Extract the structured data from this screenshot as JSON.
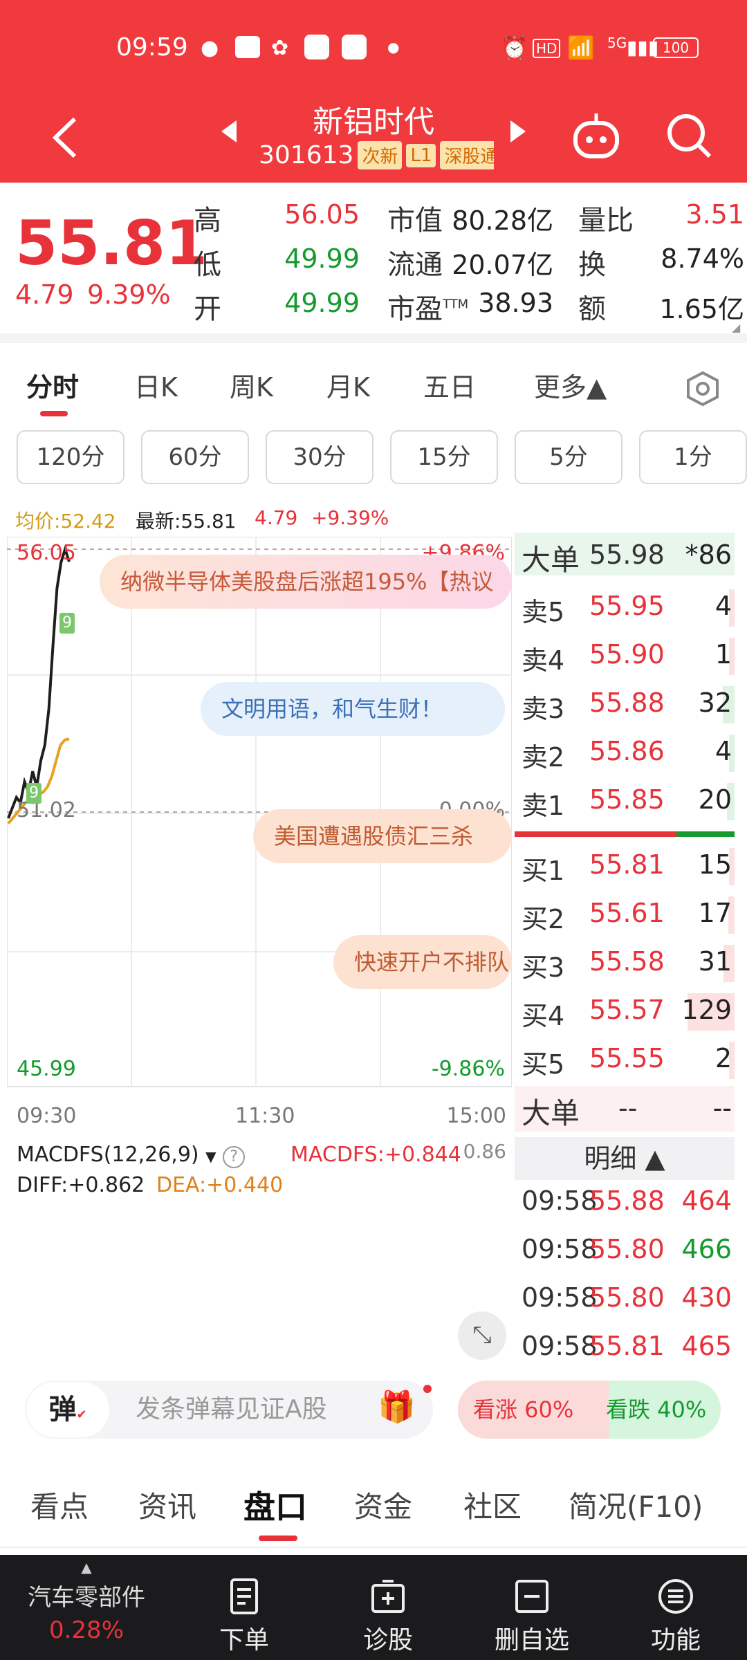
{
  "status": {
    "time": "09:59",
    "battery": "100",
    "network": "5G",
    "hd": "HD"
  },
  "header": {
    "title": "新铝时代",
    "code": "301613",
    "tags": [
      "次新",
      "L1",
      "深股通"
    ]
  },
  "quote": {
    "price": "55.81",
    "change": "4.79",
    "pct": "9.39%",
    "high_label": "高",
    "high": "56.05",
    "low_label": "低",
    "low": "49.99",
    "open_label": "开",
    "open": "49.99",
    "mktcap_label": "市值",
    "mktcap": "80.28亿",
    "float_label": "流通",
    "float": "20.07亿",
    "pe_label": "市盈",
    "pe_sup": "TTM",
    "pe": "38.93",
    "vr_label": "量比",
    "vr": "3.51",
    "turn_label": "换",
    "turn": "8.74%",
    "amt_label": "额",
    "amt": "1.65亿"
  },
  "ktabs": [
    "分时",
    "日K",
    "周K",
    "月K",
    "五日",
    "更多▲"
  ],
  "ranges": [
    "120分",
    "60分",
    "30分",
    "15分",
    "5分",
    "1分"
  ],
  "avgline": {
    "avg": "均价:52.42",
    "latest": "最新:55.81",
    "chg": "4.79",
    "pct": "+9.39%"
  },
  "chart_data": {
    "type": "line",
    "price_axis": {
      "top": "56.05",
      "mid": "51.02",
      "bottom": "45.99"
    },
    "pct_axis": {
      "top": "+9.86%",
      "mid": "0.00%",
      "bottom": "-9.86%"
    },
    "time_axis": [
      "09:30",
      "11:30",
      "15:00"
    ],
    "series": [
      {
        "values": [
          50.9,
          51.1,
          51.3,
          51.2,
          51.6,
          51.4,
          51.8,
          51.5,
          52.0,
          52.3,
          53.0,
          54.2,
          55.3,
          55.8,
          56.05,
          55.81
        ]
      },
      {
        "values": [
          50.8,
          50.9,
          51.0,
          51.1,
          51.2,
          51.25,
          51.3,
          51.35,
          51.4,
          51.5,
          51.7,
          52.0,
          52.3,
          52.4,
          52.42
        ]
      }
    ],
    "markers": [
      "9",
      "9"
    ]
  },
  "macd": {
    "name": "MACDFS(12,26,9)",
    "macdfs": "MACDFS:+0.844",
    "diff": "DIFF:+0.862",
    "dea": "DEA:+0.440",
    "scale": "0.86"
  },
  "danmu": [
    "纳微半导体美股盘后涨超195%【热议",
    "文明用语，和气生财！",
    "美国遭遇股债汇三杀",
    "快速开户不排队"
  ],
  "orderbook": {
    "bigorder": {
      "label": "大单",
      "price": "55.98",
      "vol": "*86"
    },
    "sells": [
      {
        "l": "卖5",
        "p": "55.95",
        "v": "4"
      },
      {
        "l": "卖4",
        "p": "55.90",
        "v": "1"
      },
      {
        "l": "卖3",
        "p": "55.88",
        "v": "32"
      },
      {
        "l": "卖2",
        "p": "55.86",
        "v": "4"
      },
      {
        "l": "卖1",
        "p": "55.85",
        "v": "20"
      }
    ],
    "buys": [
      {
        "l": "买1",
        "p": "55.81",
        "v": "15"
      },
      {
        "l": "买2",
        "p": "55.61",
        "v": "17"
      },
      {
        "l": "买3",
        "p": "55.58",
        "v": "31"
      },
      {
        "l": "买4",
        "p": "55.57",
        "v": "129"
      },
      {
        "l": "买5",
        "p": "55.55",
        "v": "2"
      }
    ],
    "big2": {
      "label": "大单",
      "a": "--",
      "b": "--"
    },
    "detail_label": "明细 ▲",
    "ticks": [
      {
        "t": "09:58",
        "p": "55.88",
        "v": "464"
      },
      {
        "t": "09:58",
        "p": "55.80",
        "v": "466"
      },
      {
        "t": "09:58",
        "p": "55.80",
        "v": "430"
      },
      {
        "t": "09:58",
        "p": "55.81",
        "v": "465"
      }
    ]
  },
  "comment": {
    "dan": "弹",
    "placeholder": "发条弹幕见证A股",
    "up": "看涨 60%",
    "down": "看跌 40%",
    "up_share": 0.6
  },
  "subtabs": [
    "看点",
    "资讯",
    "盘口",
    "资金",
    "社区",
    "简况(F10)"
  ],
  "bottomnav": {
    "sector": "汽车零部件",
    "sector_pct": "0.28%",
    "items": [
      "下单",
      "诊股",
      "删自选",
      "功能"
    ]
  }
}
